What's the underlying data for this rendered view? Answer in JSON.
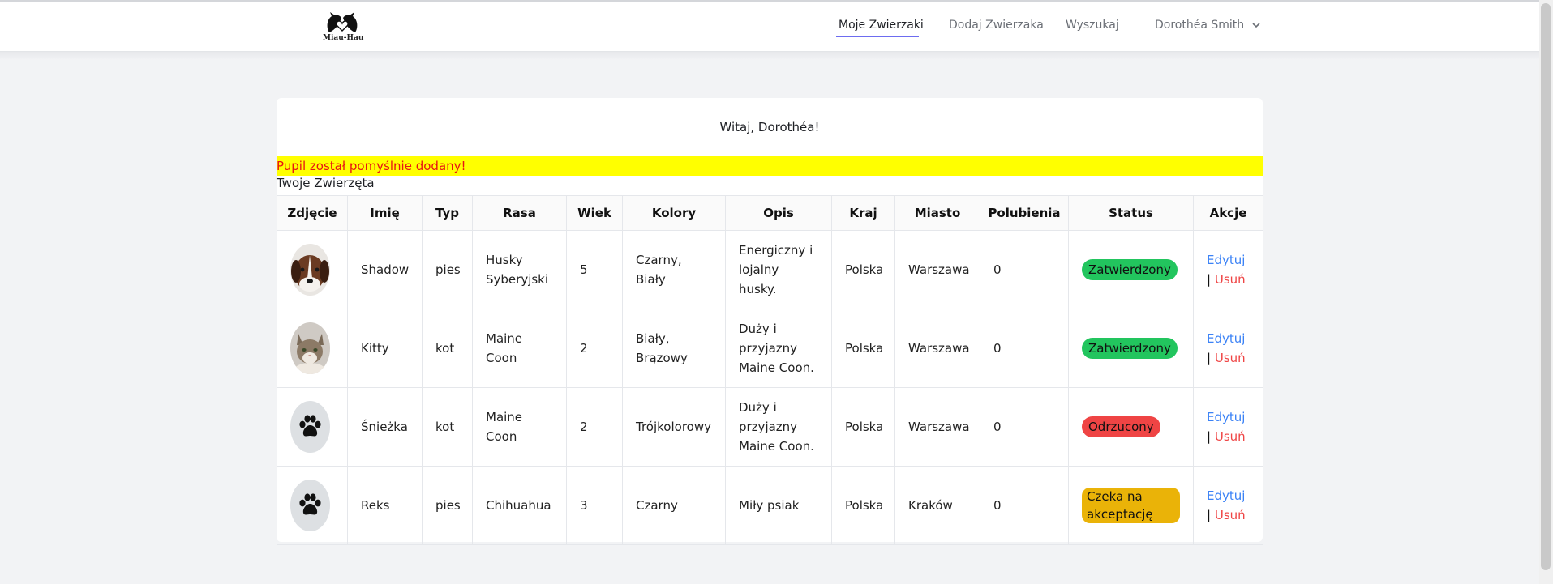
{
  "brand": {
    "logo_text": "Miau-Hau",
    "logo_icon": "cat-dog-heart-logo"
  },
  "nav": {
    "links": [
      {
        "label": "Moje Zwierzaki",
        "active": true
      },
      {
        "label": "Dodaj Zwierzaka",
        "active": false
      },
      {
        "label": "Wyszukaj",
        "active": false
      }
    ],
    "user": {
      "name": "Dorothéa Smith",
      "icon": "chevron-down-icon"
    }
  },
  "main": {
    "welcome": "Witaj, Dorothéa!",
    "alert": "Pupil został pomyślnie dodany!",
    "section_title": "Twoje Zwierzęta"
  },
  "table": {
    "headers": [
      "Zdjęcie",
      "Imię",
      "Typ",
      "Rasa",
      "Wiek",
      "Kolory",
      "Opis",
      "Kraj",
      "Miasto",
      "Polubienia",
      "Status",
      "Akcje"
    ],
    "rows": [
      {
        "photo": "dog-photo",
        "name": "Shadow",
        "type": "pies",
        "breed": "Husky Syberyjski",
        "age": "5",
        "colors": "Czarny, Biały",
        "description": "Energiczny i lojalny husky.",
        "country": "Polska",
        "city": "Warszawa",
        "likes": "0",
        "status": "Zatwierdzony",
        "status_kind": "approved",
        "edit": "Edytuj",
        "delete": "Usuń"
      },
      {
        "photo": "cat-photo",
        "name": "Kitty",
        "type": "kot",
        "breed": "Maine Coon",
        "age": "2",
        "colors": "Biały, Brązowy",
        "description": "Duży i przyjazny Maine Coon.",
        "country": "Polska",
        "city": "Warszawa",
        "likes": "0",
        "status": "Zatwierdzony",
        "status_kind": "approved",
        "edit": "Edytuj",
        "delete": "Usuń"
      },
      {
        "photo": "paw-placeholder-icon",
        "name": "Śnieżka",
        "type": "kot",
        "breed": "Maine Coon",
        "age": "2",
        "colors": "Trójkolorowy",
        "description": "Duży i przyjazny Maine Coon.",
        "country": "Polska",
        "city": "Warszawa",
        "likes": "0",
        "status": "Odrzucony",
        "status_kind": "rejected",
        "edit": "Edytuj",
        "delete": "Usuń"
      },
      {
        "photo": "paw-placeholder-icon",
        "name": "Reks",
        "type": "pies",
        "breed": "Chihuahua",
        "age": "3",
        "colors": "Czarny",
        "description": "Miły psiak",
        "country": "Polska",
        "city": "Kraków",
        "likes": "0",
        "status": "Czeka na akceptację",
        "status_kind": "pending",
        "edit": "Edytuj",
        "delete": "Usuń"
      }
    ]
  },
  "colors": {
    "approved": "#22c55e",
    "rejected": "#ef4444",
    "pending": "#eab308",
    "link": "#3b82f6",
    "alert_bg": "#ffff00",
    "alert_text": "#e81313",
    "nav_underline": "#6d6cf0"
  }
}
